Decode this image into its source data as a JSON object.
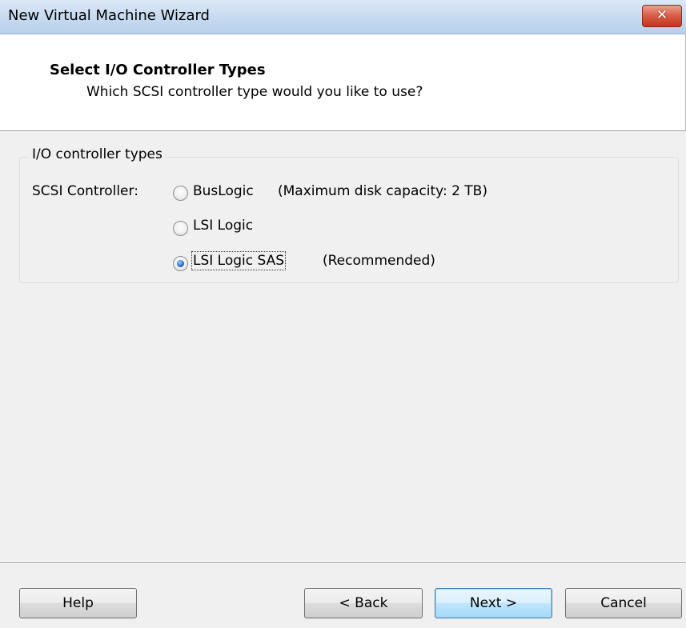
{
  "window": {
    "title": "New Virtual Machine Wizard",
    "close_glyph": "✕"
  },
  "header": {
    "title": "Select I/O Controller Types",
    "subtitle": "Which SCSI controller type would you like to use?"
  },
  "group": {
    "legend": "I/O controller types",
    "scsi_label": "SCSI Controller:",
    "options": [
      {
        "label": "BusLogic",
        "note": "(Maximum disk capacity: 2 TB)",
        "checked": false
      },
      {
        "label": "LSI Logic",
        "note": "",
        "checked": false
      },
      {
        "label": "LSI Logic SAS",
        "note": "(Recommended)",
        "checked": true
      }
    ]
  },
  "buttons": {
    "help": "Help",
    "back": "< Back",
    "next": "Next >",
    "cancel": "Cancel"
  }
}
